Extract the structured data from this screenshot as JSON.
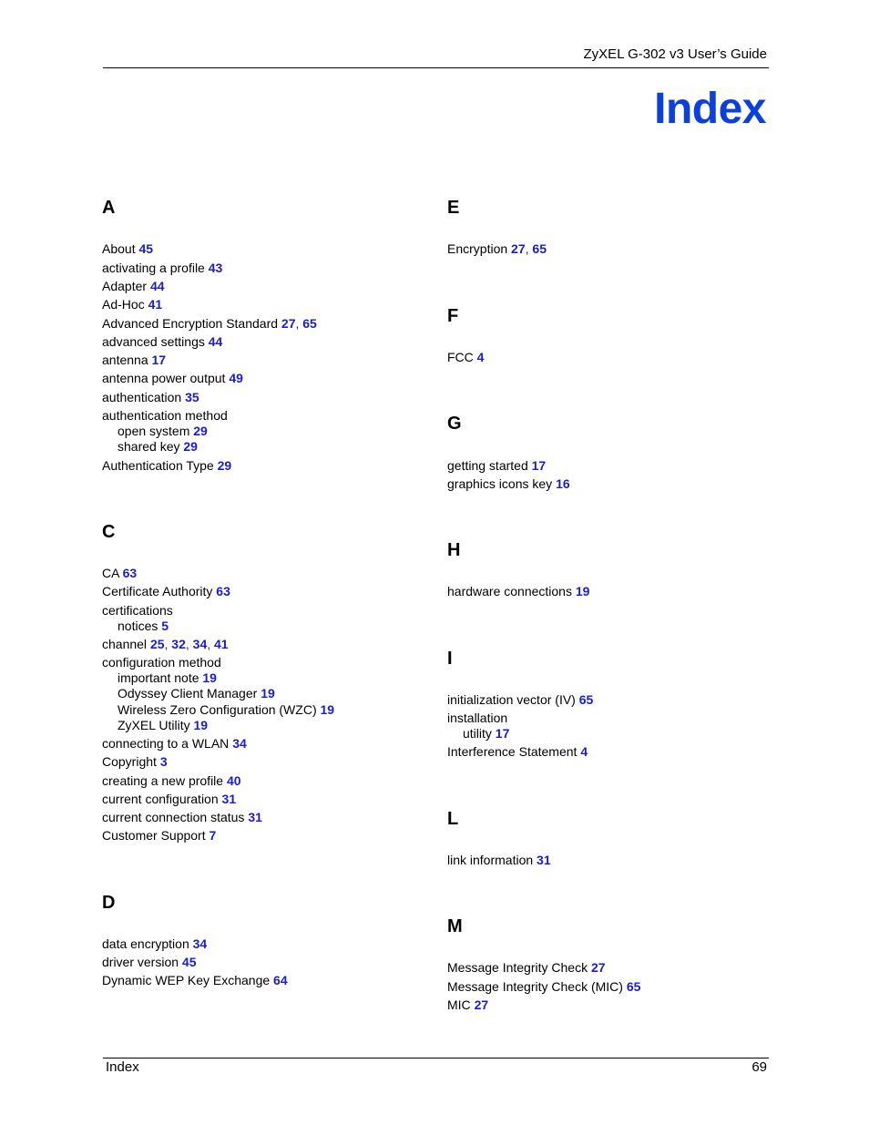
{
  "header": {
    "guide_title": "ZyXEL G-302 v3 User’s Guide"
  },
  "page_title": "Index",
  "footer": {
    "section": "Index",
    "page_number": "69"
  },
  "index_colors": {
    "title": "#0b3fe0",
    "page_ref": "#1a1adf"
  },
  "sections": [
    {
      "letter": "A",
      "entries": [
        {
          "term": "About",
          "pages": [
            "45"
          ]
        },
        {
          "term": "activating a profile",
          "pages": [
            "43"
          ]
        },
        {
          "term": "Adapter",
          "pages": [
            "44"
          ]
        },
        {
          "term": "Ad-Hoc",
          "pages": [
            "41"
          ]
        },
        {
          "term": "Advanced Encryption Standard",
          "pages": [
            "27",
            "65"
          ]
        },
        {
          "term": "advanced settings",
          "pages": [
            "44"
          ]
        },
        {
          "term": "antenna",
          "pages": [
            "17"
          ]
        },
        {
          "term": "antenna power output",
          "pages": [
            "49"
          ]
        },
        {
          "term": "authentication",
          "pages": [
            "35"
          ]
        },
        {
          "term": "authentication method",
          "pages": []
        },
        {
          "term": "open system",
          "pages": [
            "29"
          ],
          "sub": true
        },
        {
          "term": "shared key",
          "pages": [
            "29"
          ],
          "sub": true
        },
        {
          "term": "Authentication Type",
          "pages": [
            "29"
          ]
        }
      ]
    },
    {
      "letter": "C",
      "entries": [
        {
          "term": "CA",
          "pages": [
            "63"
          ]
        },
        {
          "term": "Certificate Authority",
          "pages": [
            "63"
          ]
        },
        {
          "term": "certifications",
          "pages": []
        },
        {
          "term": "notices",
          "pages": [
            "5"
          ],
          "sub": true
        },
        {
          "term": "channel",
          "pages": [
            "25",
            "32",
            "34",
            "41"
          ]
        },
        {
          "term": "configuration method",
          "pages": []
        },
        {
          "term": "important note",
          "pages": [
            "19"
          ],
          "sub": true
        },
        {
          "term": "Odyssey Client Manager",
          "pages": [
            "19"
          ],
          "sub": true
        },
        {
          "term": "Wireless Zero Configuration (WZC)",
          "pages": [
            "19"
          ],
          "sub": true
        },
        {
          "term": "ZyXEL Utility",
          "pages": [
            "19"
          ],
          "sub": true
        },
        {
          "term": "connecting to a WLAN",
          "pages": [
            "34"
          ]
        },
        {
          "term": "Copyright",
          "pages": [
            "3"
          ]
        },
        {
          "term": "creating a new profile",
          "pages": [
            "40"
          ]
        },
        {
          "term": "current configuration",
          "pages": [
            "31"
          ]
        },
        {
          "term": "current connection status",
          "pages": [
            "31"
          ]
        },
        {
          "term": "Customer Support",
          "pages": [
            "7"
          ]
        }
      ]
    },
    {
      "letter": "D",
      "entries": [
        {
          "term": "data encryption",
          "pages": [
            "34"
          ]
        },
        {
          "term": "driver version",
          "pages": [
            "45"
          ]
        },
        {
          "term": "Dynamic WEP Key Exchange",
          "pages": [
            "64"
          ]
        }
      ]
    },
    {
      "letter": "E",
      "entries": [
        {
          "term": "Encryption",
          "pages": [
            "27",
            "65"
          ]
        }
      ]
    },
    {
      "letter": "F",
      "entries": [
        {
          "term": "FCC",
          "pages": [
            "4"
          ]
        }
      ]
    },
    {
      "letter": "G",
      "entries": [
        {
          "term": "getting started",
          "pages": [
            "17"
          ]
        },
        {
          "term": "graphics icons key",
          "pages": [
            "16"
          ]
        }
      ]
    },
    {
      "letter": "H",
      "entries": [
        {
          "term": "hardware connections",
          "pages": [
            "19"
          ]
        }
      ]
    },
    {
      "letter": "I",
      "entries": [
        {
          "term": "initialization vector (IV)",
          "pages": [
            "65"
          ]
        },
        {
          "term": "installation",
          "pages": []
        },
        {
          "term": "utility",
          "pages": [
            "17"
          ],
          "sub": true
        },
        {
          "term": "Interference Statement",
          "pages": [
            "4"
          ]
        }
      ]
    },
    {
      "letter": "L",
      "entries": [
        {
          "term": "link information",
          "pages": [
            "31"
          ]
        }
      ]
    },
    {
      "letter": "M",
      "entries": [
        {
          "term": "Message Integrity Check",
          "pages": [
            "27"
          ]
        },
        {
          "term": "Message Integrity Check (MIC)",
          "pages": [
            "65"
          ]
        },
        {
          "term": "MIC",
          "pages": [
            "27"
          ]
        }
      ]
    }
  ]
}
